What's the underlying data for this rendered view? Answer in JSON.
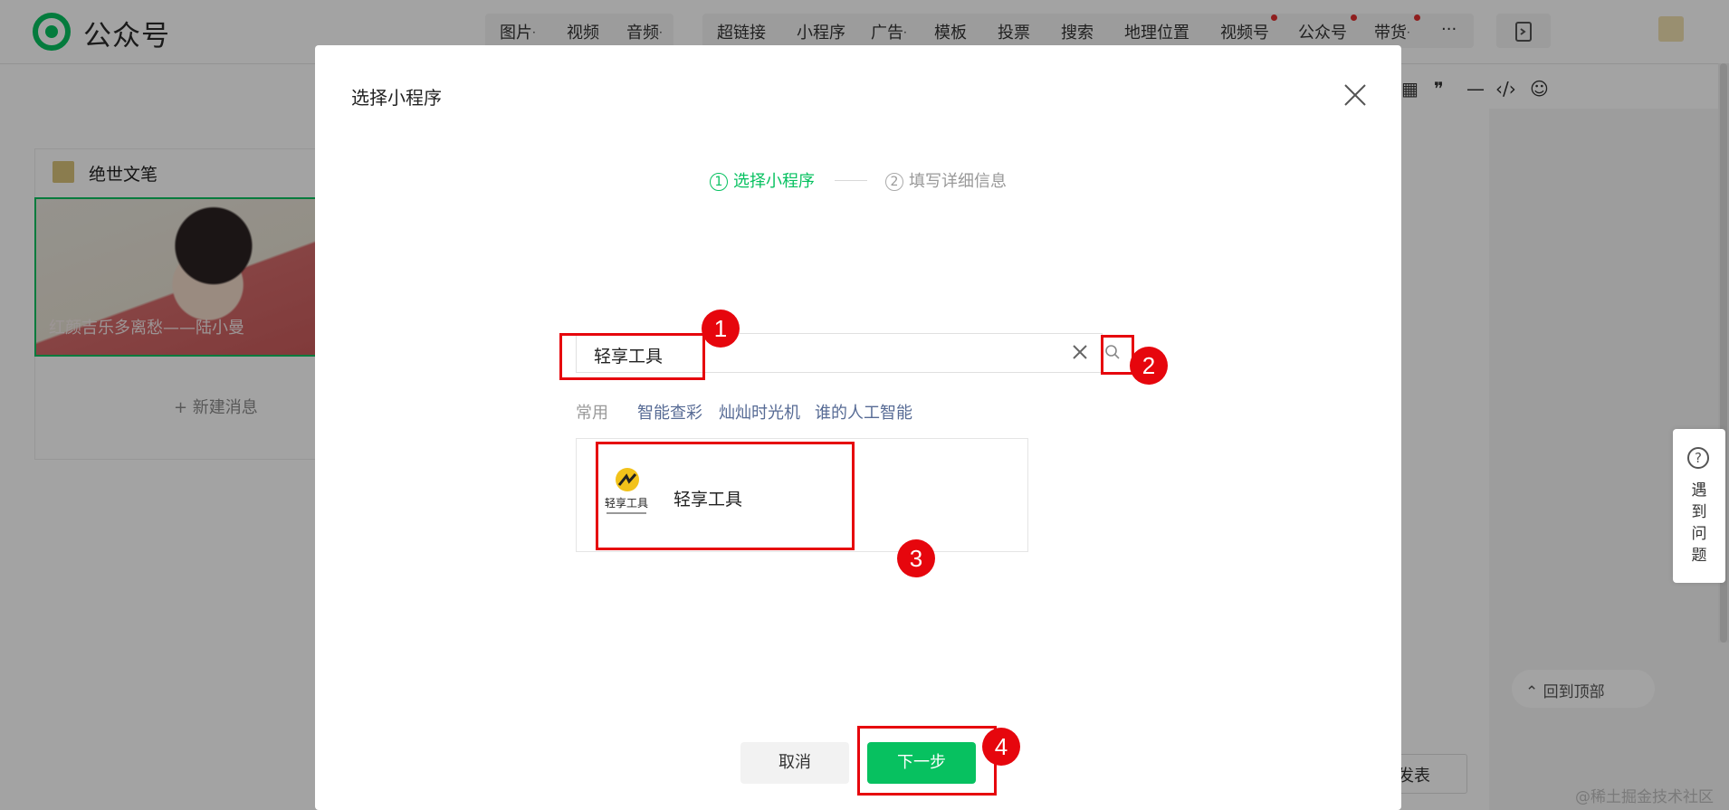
{
  "app": {
    "name": "公众号"
  },
  "toolbar": {
    "items": [
      {
        "label": "图片",
        "dropdown": "·"
      },
      {
        "label": "视频"
      },
      {
        "label": "音频",
        "dropdown": "·"
      },
      {
        "label": "超链接"
      },
      {
        "label": "小程序"
      },
      {
        "label": "广告",
        "dropdown": "·"
      },
      {
        "label": "模板"
      },
      {
        "label": "投票"
      },
      {
        "label": "搜索"
      },
      {
        "label": "地理位置"
      },
      {
        "label": "视频号"
      },
      {
        "label": "公众号"
      },
      {
        "label": "带货",
        "dropdown": "·"
      },
      {
        "label": "···"
      }
    ]
  },
  "left_panel": {
    "account_name": "绝世文笔",
    "cover_caption": "红颜吉乐多离愁——陆小曼",
    "new_message": "+ 新建消息"
  },
  "right": {
    "help_label": "遇到问题",
    "back_to_top": "⌃ 回到顶部",
    "publish_partial": "发表",
    "watermark": "@稀土掘金技术社区"
  },
  "dialog": {
    "title": "选择小程序",
    "steps": [
      {
        "num": "1",
        "label": "选择小程序",
        "active": true
      },
      {
        "num": "2",
        "label": "填写详细信息",
        "active": false
      }
    ],
    "search": {
      "value": "轻享工具"
    },
    "quick": {
      "label": "常用",
      "items": [
        "智能查彩",
        "灿灿时光机",
        "谁的人工智能"
      ]
    },
    "result": {
      "name": "轻享工具",
      "logo_text": "轻享工具"
    },
    "buttons": {
      "cancel": "取消",
      "next": "下一步"
    }
  },
  "annotations": [
    "1",
    "2",
    "3",
    "4"
  ],
  "colors": {
    "accent": "#07c160",
    "link": "#576b95",
    "annotation": "#e6060d"
  }
}
